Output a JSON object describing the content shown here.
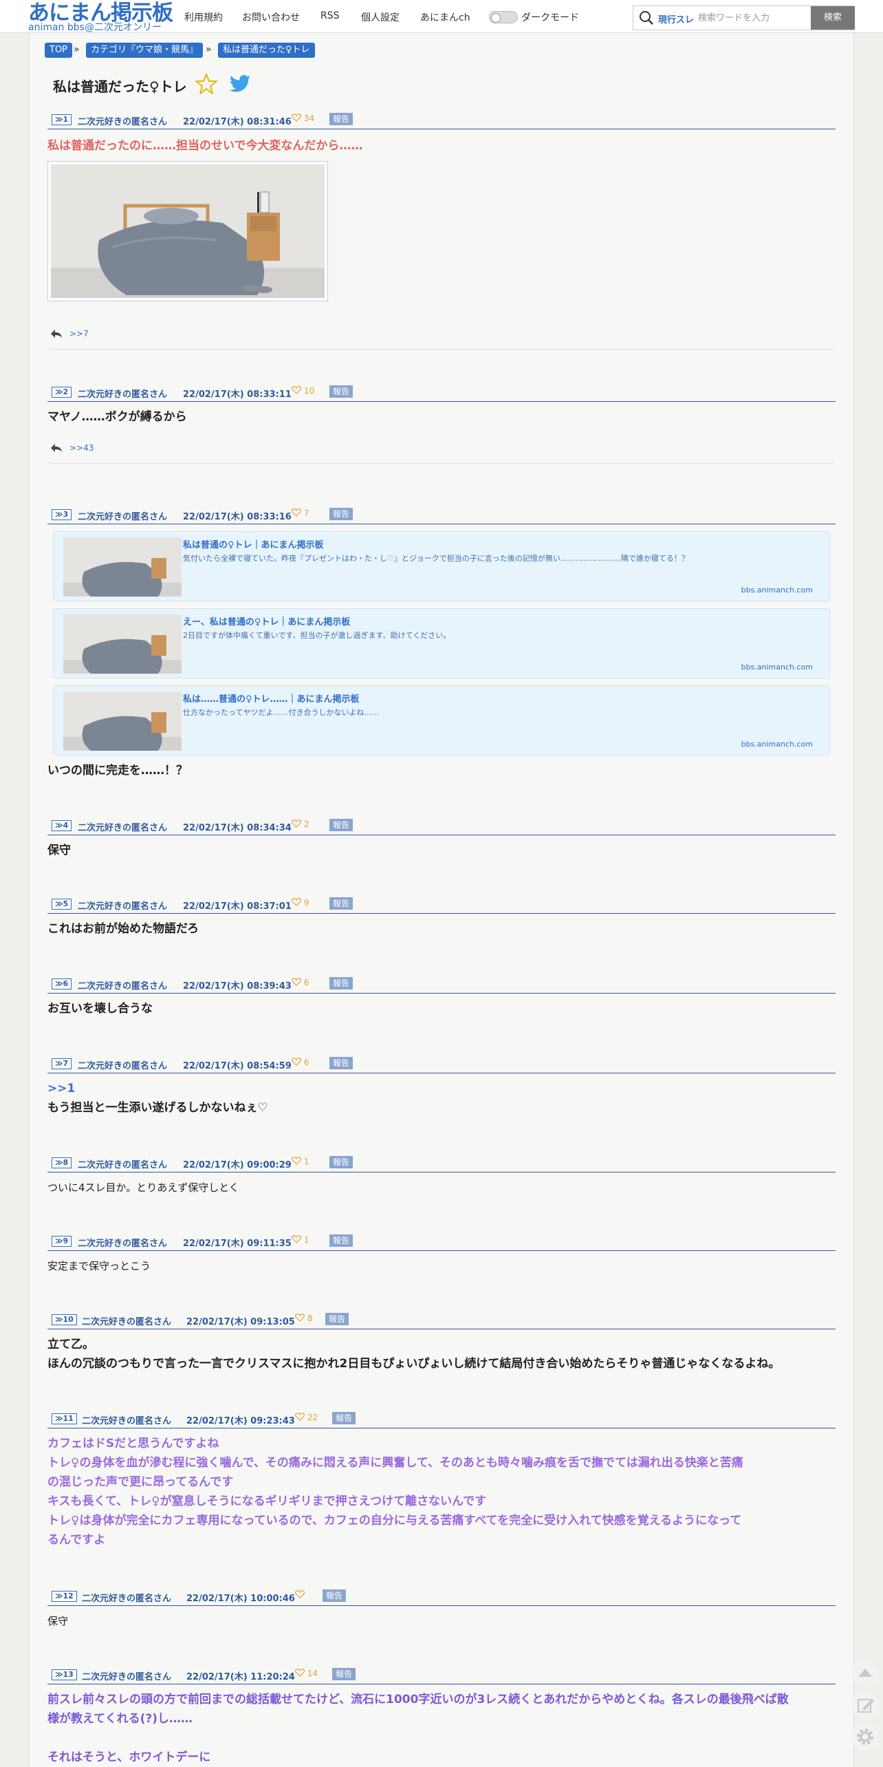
{
  "header": {
    "logo": "あにまん掲示板",
    "logo_sub": "animan bbs@二次元オンリー",
    "nav": [
      "利用規約",
      "お問い合わせ",
      "RSS",
      "個人設定",
      "あにまんch"
    ],
    "dark_mode_label": "ダークモード",
    "search": {
      "scope": "現行スレ",
      "placeholder": "検索ワードを入力",
      "button": "検索"
    }
  },
  "breadcrumbs": [
    "TOP",
    "カテゴリ『ウマ娘・競馬』",
    "私は普通だった♀トレ"
  ],
  "breadcrumb_sep": "»",
  "thread_title": "私は普通だった♀トレ",
  "report_label": "報告",
  "posts": [
    {
      "num": "1",
      "name": "二次元好きの匿名さん",
      "date": "22/02/17(木) 08:31:46",
      "likes": "34",
      "lines": [
        "私は普通だったのに……担当のせいで今大変なんだから……"
      ],
      "reply": ">>7"
    },
    {
      "num": "2",
      "name": "二次元好きの匿名さん",
      "date": "22/02/17(木) 08:33:11",
      "likes": "10",
      "lines": [
        "マヤノ……ボクが縛るから"
      ],
      "reply": ">>43"
    },
    {
      "num": "3",
      "name": "二次元好きの匿名さん",
      "date": "22/02/17(木) 08:33:16",
      "likes": "7",
      "lines": [
        "いつの間に完走を……！？"
      ],
      "cards": [
        {
          "title": "私は普通の♀トレ｜あにまん掲示板",
          "desc": "気付いたら全裸で寝ていた。昨夜『プレゼントはわ・た・し♡』とジョークで担当の子に言った後の記憶が無い……………………隣で誰か寝てる！？",
          "site": "bbs.animanch.com"
        },
        {
          "title": "えー、私は普通の♀トレ｜あにまん掲示板",
          "desc": "2日目ですが体中痛くて重いです、担当の子が激し過ぎます、助けてください。",
          "site": "bbs.animanch.com"
        },
        {
          "title": "私は……普通の♀トレ……｜あにまん掲示板",
          "desc": "仕方なかったってヤツだよ……付き合うしかないよね……",
          "site": "bbs.animanch.com"
        }
      ]
    },
    {
      "num": "4",
      "name": "二次元好きの匿名さん",
      "date": "22/02/17(木) 08:34:34",
      "likes": "2",
      "lines": [
        "保守"
      ]
    },
    {
      "num": "5",
      "name": "二次元好きの匿名さん",
      "date": "22/02/17(木) 08:37:01",
      "likes": "9",
      "lines": [
        "これはお前が始めた物語だろ"
      ]
    },
    {
      "num": "6",
      "name": "二次元好きの匿名さん",
      "date": "22/02/17(木) 08:39:43",
      "likes": "6",
      "lines": [
        "お互いを壊し合うな"
      ]
    },
    {
      "num": "7",
      "name": "二次元好きの匿名さん",
      "date": "22/02/17(木) 08:54:59",
      "likes": "6",
      "anchor": ">>1",
      "lines": [
        "もう担当と一生添い遂げるしかないねぇ♡"
      ]
    },
    {
      "num": "8",
      "name": "二次元好きの匿名さん",
      "date": "22/02/17(木) 09:00:29",
      "likes": "1",
      "lines": [
        "ついに4スレ目か。とりあえず保守しとく"
      ]
    },
    {
      "num": "9",
      "name": "二次元好きの匿名さん",
      "date": "22/02/17(木) 09:11:35",
      "likes": "1",
      "lines": [
        "安定まで保守っとこう"
      ]
    },
    {
      "num": "10",
      "name": "二次元好きの匿名さん",
      "date": "22/02/17(木) 09:13:05",
      "likes": "8",
      "lines": [
        "立て乙。",
        "ほんの冗談のつもりで言った一言でクリスマスに抱かれ2日目もぴょいぴょいし続けて結局付き合い始めたらそりゃ普通じゃなくなるよね。"
      ]
    },
    {
      "num": "11",
      "name": "二次元好きの匿名さん",
      "date": "22/02/17(木) 09:23:43",
      "likes": "22",
      "lines": [
        "カフェはドSだと思うんですよね",
        "トレ♀の身体を血が滲む程に強く噛んで、その痛みに悶える声に興奮して、そのあとも時々噛み痕を舌で撫でては漏れ出る快楽と苦痛",
        "の混じった声で更に昂ってるんです",
        "キスも長くて、トレ♀が窒息しそうになるギリギリまで押さえつけて離さないんです",
        "トレ♀は身体が完全にカフェ専用になっているので、カフェの自分に与える苦痛すべてを完全に受け入れて快感を覚えるようになって",
        "るんですよ"
      ]
    },
    {
      "num": "12",
      "name": "二次元好きの匿名さん",
      "date": "22/02/17(木) 10:00:46",
      "likes": "",
      "lines": [
        "保守"
      ]
    },
    {
      "num": "13",
      "name": "二次元好きの匿名さん",
      "date": "22/02/17(木) 11:20:24",
      "likes": "14",
      "lines": [
        "前スレ前々スレの頭の方で前回までの総括載せてたけど、流石に1000字近いのが3レス続くとあれだからやめとくね。各スレの最後飛べば散",
        "様が教えてくれる(?)し……",
        "",
        "それはそうと、ホワイトデーに"
      ]
    }
  ]
}
